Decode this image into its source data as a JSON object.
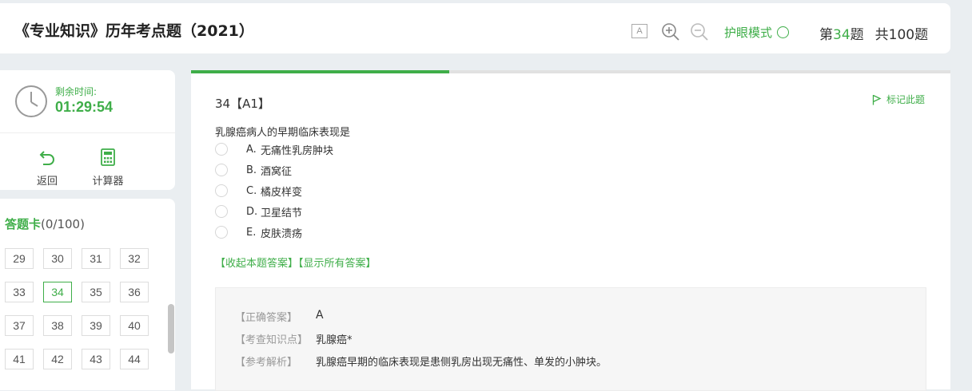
{
  "header": {
    "title": "《专业知识》历年考点题（2021）",
    "font_tool_glyph": "A",
    "eye_mode_label": "护眼模式",
    "question_prefix": "第",
    "question_current": "34",
    "question_suffix": "题",
    "total_label": "共100题"
  },
  "timer": {
    "label": "剩余时间:",
    "value": "01:29:54"
  },
  "tools": {
    "back_label": "返回",
    "calculator_label": "计算器"
  },
  "answer_card": {
    "title": "答题卡",
    "count": "(0/100)",
    "rows": [
      [
        "29",
        "30",
        "31",
        "32"
      ],
      [
        "33",
        "34",
        "35",
        "36"
      ],
      [
        "37",
        "38",
        "39",
        "40"
      ],
      [
        "41",
        "42",
        "43",
        "44"
      ]
    ],
    "active": "34"
  },
  "question": {
    "progress_percent": 34,
    "number_label": "34【A1】",
    "flag_label": "标记此题",
    "stem": "乳腺癌病人的早期临床表现是",
    "options": [
      {
        "letter": "A.",
        "text": "无痛性乳房肿块"
      },
      {
        "letter": "B.",
        "text": "酒窝征"
      },
      {
        "letter": "C.",
        "text": "橘皮样变"
      },
      {
        "letter": "D.",
        "text": "卫星结节"
      },
      {
        "letter": "E.",
        "text": "皮肤溃疡"
      }
    ],
    "collapse_link": "【收起本题答案】",
    "show_all_link": "【显示所有答案】"
  },
  "answer": {
    "correct_label": "【正确答案】",
    "correct_value": "A",
    "knowledge_label": "【考查知识点】",
    "knowledge_value": "乳腺癌*",
    "analysis_label": "【参考解析】",
    "analysis_value": "乳腺癌早期的临床表现是患侧乳房出现无痛性、单发的小肿块。"
  },
  "colors": {
    "accent": "#3fae49",
    "background": "#eaeef1"
  }
}
